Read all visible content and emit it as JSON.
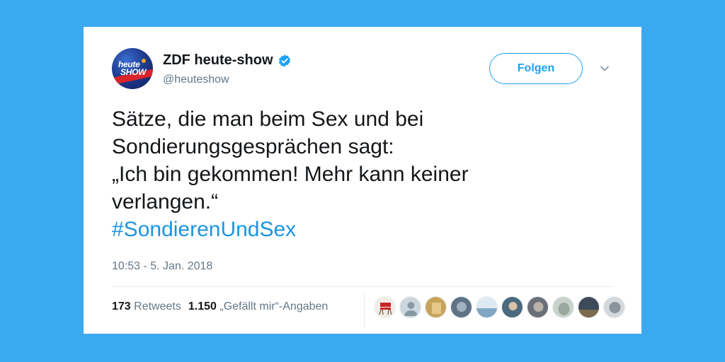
{
  "tweet": {
    "avatar": {
      "label_line1": "heute",
      "label_line2": "SHOW"
    },
    "display_name": "ZDF heute-show",
    "handle": "@heuteshow",
    "follow_label": "Folgen",
    "text_lines": [
      "Sätze, die man beim Sex und bei",
      "Sondierungsgesprächen sagt:",
      "„Ich bin gekommen! Mehr kann keiner",
      "verlangen.“"
    ],
    "hashtag": "#SondierenUndSex",
    "timestamp": "10:53 - 5. Jan. 2018",
    "retweets_count": "173",
    "retweets_label": "Retweets",
    "likes_count": "1.150",
    "likes_label": "„Gefällt mir“-Angaben",
    "liker_avatars": [
      {
        "icon": "chair-icon",
        "color": "#e8e2d6"
      },
      {
        "icon": "default-user-icon",
        "color": "#ccd6dd"
      },
      {
        "icon": "user-photo-icon",
        "color": "#c7a45a"
      },
      {
        "icon": "user-photo-icon",
        "color": "#5f7286"
      },
      {
        "icon": "user-photo-icon",
        "color": "#7fa6c4"
      },
      {
        "icon": "user-photo-icon",
        "color": "#4c6a7e"
      },
      {
        "icon": "user-photo-icon",
        "color": "#6a6f78"
      },
      {
        "icon": "user-photo-icon",
        "color": "#9aa8a0"
      },
      {
        "icon": "user-photo-icon",
        "color": "#7a6a4e"
      },
      {
        "icon": "user-photo-icon",
        "color": "#8b939b"
      }
    ]
  },
  "colors": {
    "background": "#3aa9f0",
    "accent": "#1da1f2",
    "hashtag": "#1b95e0",
    "text": "#14171a",
    "secondary": "#657786"
  }
}
